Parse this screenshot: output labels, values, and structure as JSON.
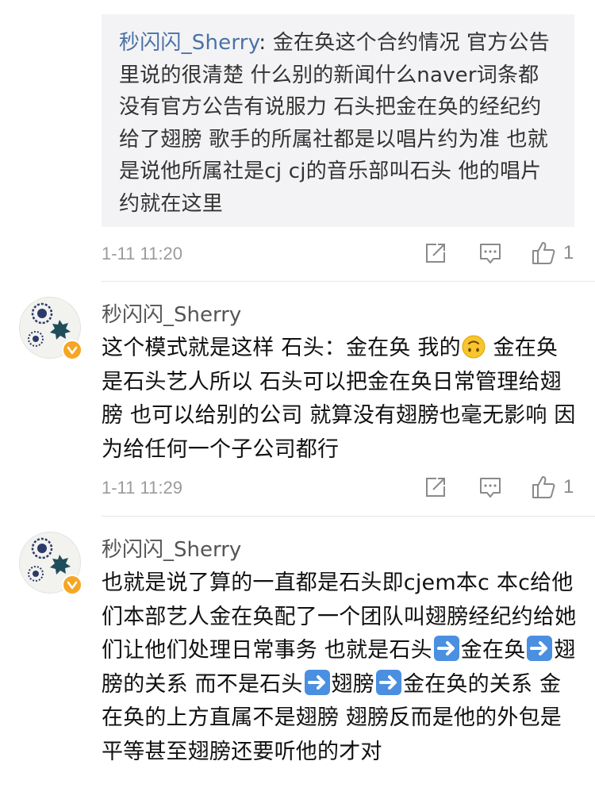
{
  "quote": {
    "author": "秒闪闪_Sherry",
    "separator": ": ",
    "text": "金在奂这个合约情况 官方公告里说的很清楚 什么别的新闻什么naver词条都没有官方公告有说服力 石头把金在奂的经纪约给了翅膀 歌手的所属社都是以唱片约为准 也就是说他所属社是cj cj的音乐部叫石头 他的唱片约就在这里",
    "time": "1-11 11:20",
    "likes": "1"
  },
  "comments": [
    {
      "username": "秒闪闪_Sherry",
      "text_a": "这个模式就是这样 石头：金在奂 我的",
      "emoji": "upside-down-face-emoji",
      "text_b": " 金在奂是石头艺人所以 石头可以把金在奂日常管理给翅膀 也可以给别的公司 就算没有翅膀也毫无影响 因为给任何一个子公司都行",
      "time": "1-11 11:29",
      "likes": "1"
    },
    {
      "username": "秒闪闪_Sherry",
      "seg1": "也就是说了算的一直都是石头即cjem本c 本c给他们本部艺人金在奂配了一个团队叫翅膀经纪约给她们让他们处理日常事务 也就是石头",
      "seg2": "金在奂",
      "seg3": "翅膀的关系 而不是石头",
      "seg4": "翅膀",
      "seg5": "金在奂的关系 金在奂的上方直属不是翅膀 翅膀反而是他的外包是平等甚至翅膀还要听他的才对"
    }
  ],
  "icons": {
    "repost": "repost-icon",
    "comment": "comment-icon",
    "like": "thumbs-up-icon",
    "verified": "verified-badge-icon",
    "arrow": "right-arrow-emoji"
  },
  "colors": {
    "author_link": "#4a72a6",
    "quote_bg": "#f3f3f5",
    "meta_gray": "#9b9b9b",
    "verified_badge": "#f5a623",
    "arrow_emoji": "#4a8fe0"
  }
}
